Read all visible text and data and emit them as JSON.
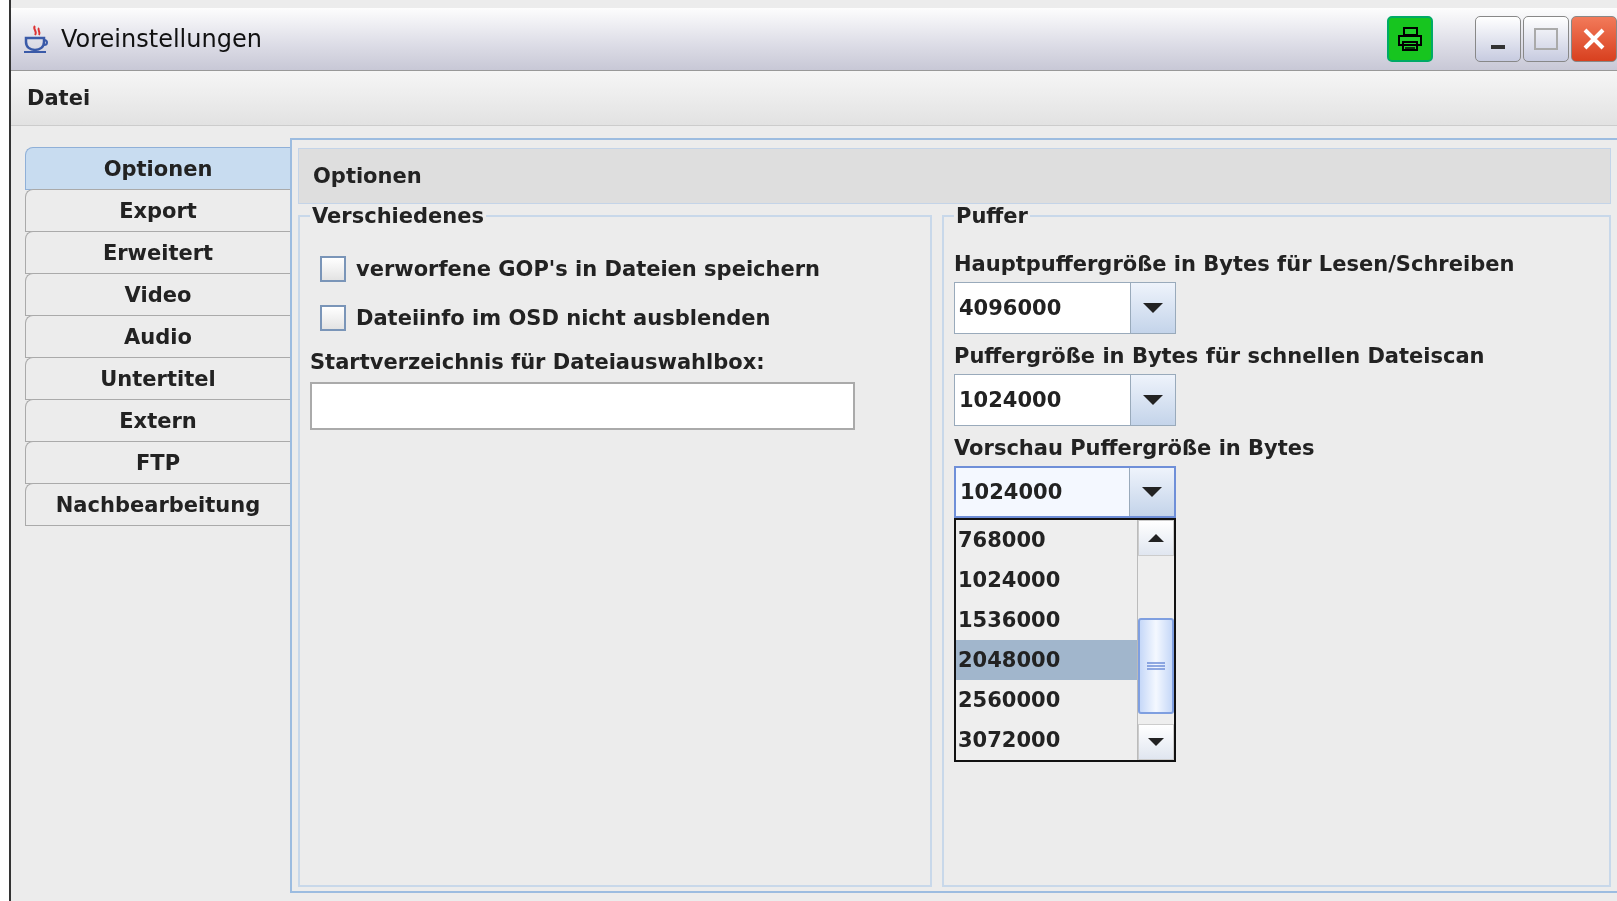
{
  "window": {
    "title": "Voreinstellungen"
  },
  "menu": [
    {
      "label": "Datei"
    }
  ],
  "sidebar": {
    "items": [
      {
        "label": "Optionen",
        "selected": true
      },
      {
        "label": "Export",
        "selected": false
      },
      {
        "label": "Erweitert",
        "selected": false
      },
      {
        "label": "Video",
        "selected": false
      },
      {
        "label": "Audio",
        "selected": false
      },
      {
        "label": "Untertitel",
        "selected": false
      },
      {
        "label": "Extern",
        "selected": false
      },
      {
        "label": "FTP",
        "selected": false
      },
      {
        "label": "Nachbearbeitung",
        "selected": false
      }
    ]
  },
  "panel": {
    "title": "Optionen",
    "left_group": {
      "title": "Verschiedenes",
      "checkboxes": [
        {
          "label": "verworfene GOP's in Dateien speichern",
          "checked": false
        },
        {
          "label": "Dateiinfo im OSD nicht ausblenden",
          "checked": false
        }
      ],
      "field_label": "Startverzeichnis für Dateiauswahlbox:"
    },
    "right_group": {
      "title": "Puffer",
      "combos": [
        {
          "label": "Hauptpuffergröße in Bytes für Lesen/Schreiben",
          "value": "4096000",
          "expanded": false
        },
        {
          "label": "Puffergröße in Bytes für schnellen Dateiscan",
          "value": "1024000",
          "expanded": false
        },
        {
          "label": "Vorschau Puffergröße in Bytes",
          "value": "1024000",
          "expanded": true,
          "options": [
            {
              "label": "768000",
              "highlighted": false
            },
            {
              "label": "1024000",
              "highlighted": false
            },
            {
              "label": "1536000",
              "highlighted": false
            },
            {
              "label": "2048000",
              "highlighted": true
            },
            {
              "label": "2560000",
              "highlighted": false
            },
            {
              "label": "3072000",
              "highlighted": false
            }
          ]
        }
      ]
    }
  }
}
